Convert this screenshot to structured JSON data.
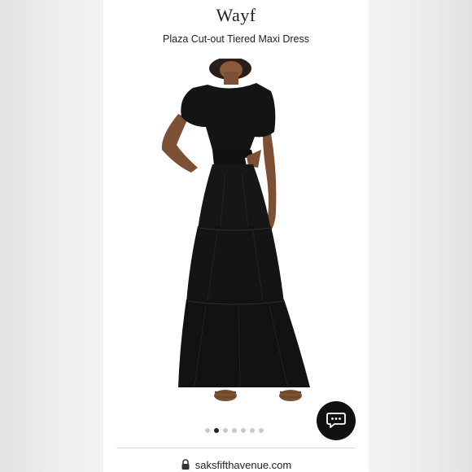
{
  "product": {
    "brand": "Wayf",
    "title": "Plaza Cut-out Tiered Maxi Dress",
    "image_icon": "product-photo-black-dress",
    "image_count": 7,
    "active_image_index": 1
  },
  "chat": {
    "icon": "chat-bubble-icon"
  },
  "browser": {
    "url": "saksfifthavenue.com",
    "lock_icon": "lock-icon"
  },
  "colors": {
    "dress": "#141414",
    "chat_button": "#111111",
    "active_dot": "#222222",
    "inactive_dot": "#c9c9c9"
  }
}
